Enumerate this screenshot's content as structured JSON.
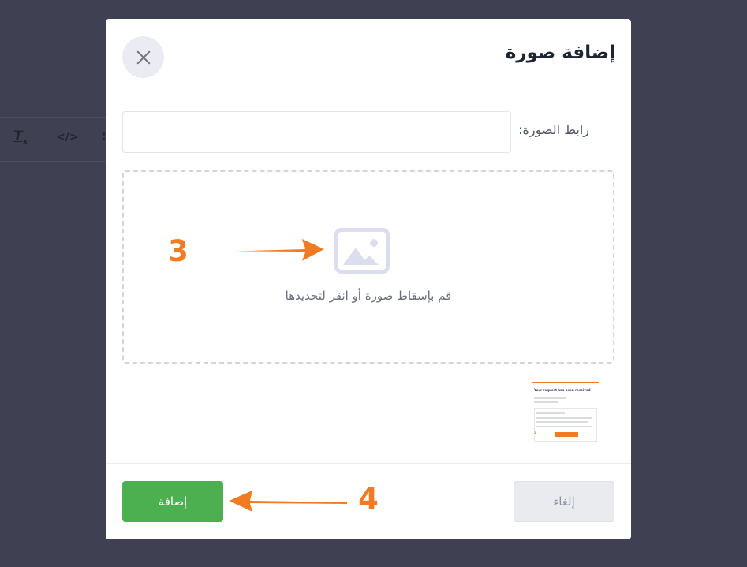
{
  "colors": {
    "backdrop": "#3f4052",
    "primary_button": "#4caf50",
    "annotation_orange": "#f27a22"
  },
  "editor_toolbar": {
    "icons": [
      "clear-format-icon",
      "code-icon",
      "more-icon"
    ]
  },
  "modal": {
    "title": "إضافة صورة",
    "close_icon": "close-icon",
    "url_field": {
      "label": "رابط الصورة:",
      "value": ""
    },
    "dropzone": {
      "icon": "image-icon",
      "text": "قم بإسقاط صورة أو انقر لتحديدها"
    },
    "thumbnail": {
      "title": "Your request has been received",
      "marker": "1"
    },
    "footer": {
      "add_label": "إضافة",
      "cancel_label": "إلغاء"
    }
  },
  "annotations": {
    "step_upload": "3",
    "step_add": "4"
  }
}
